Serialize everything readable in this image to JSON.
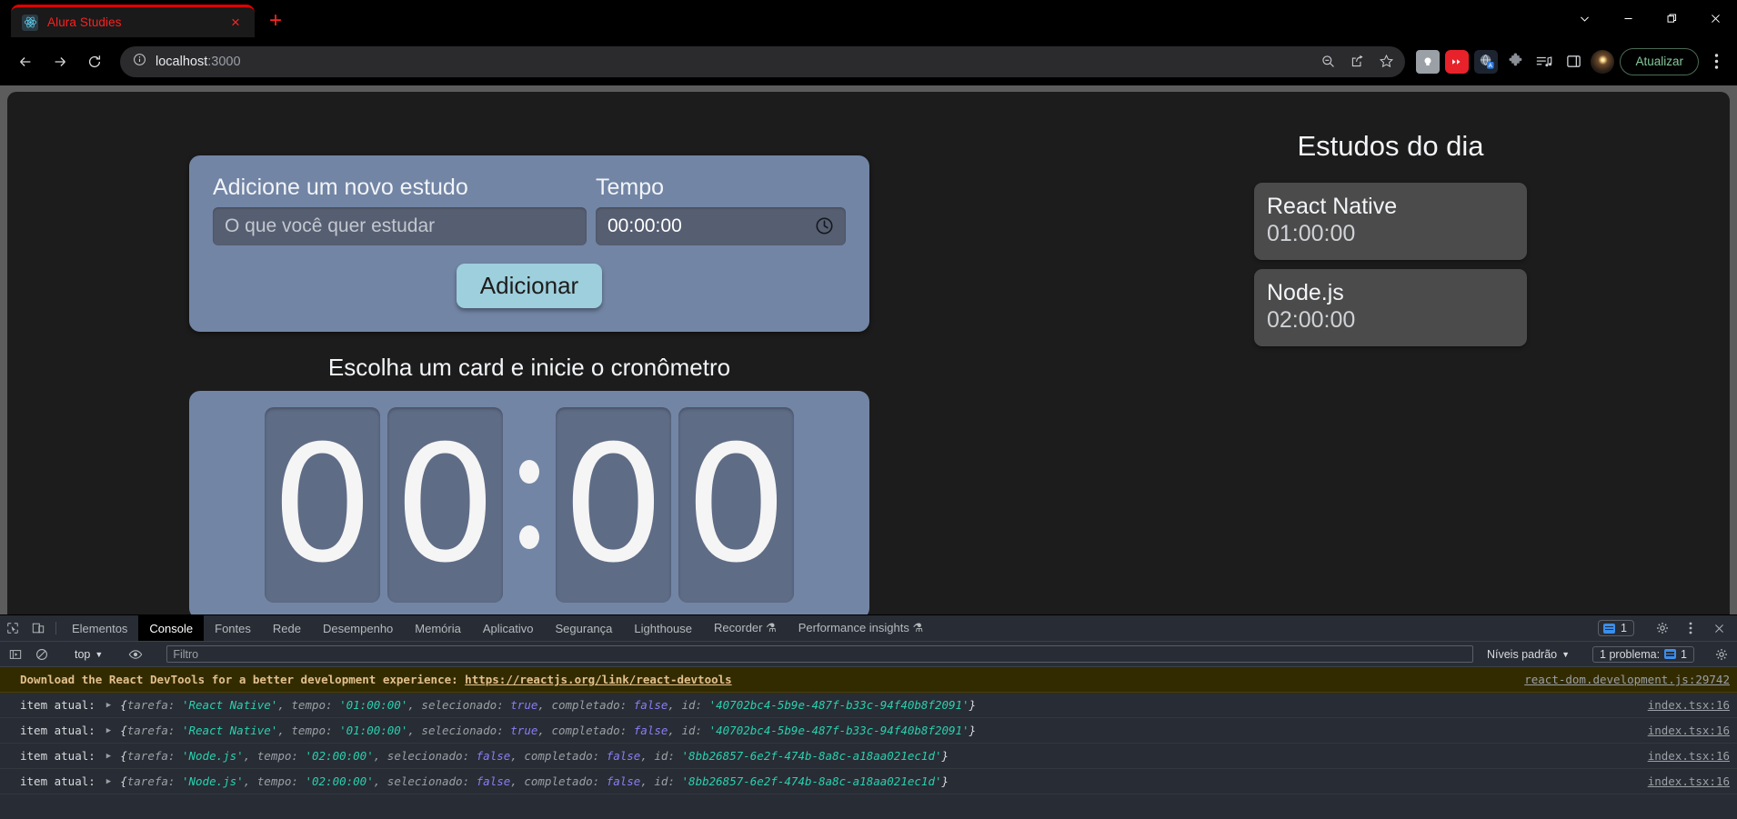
{
  "browser": {
    "tab": {
      "title": "Alura Studies",
      "favicon": "react-icon",
      "close": "×"
    },
    "new_tab_label": "+",
    "window_controls": [
      "tab-search-chevron",
      "minimize",
      "maximize",
      "close"
    ],
    "nav": {
      "back": "←",
      "forward": "→",
      "reload": "⟳"
    },
    "omnibox": {
      "info_icon": "info-circle-icon",
      "url_host": "localhost",
      "url_rest": ":3000",
      "actions": [
        "zoom-out-icon",
        "share-icon",
        "bookmark-star-icon"
      ]
    },
    "extensions": [
      "lightbulb-icon",
      "youtube-icon",
      "translate-icon",
      "puzzle-icon",
      "playlist-icon",
      "sidepanel-icon"
    ],
    "profile": "avatar",
    "update_button": "Atualizar",
    "menu": "kebab-menu"
  },
  "app": {
    "form": {
      "task_label": "Adicione um novo estudo",
      "task_placeholder": "O que você quer estudar",
      "time_label": "Tempo",
      "time_value": "00:00:00",
      "clock_icon": "clock-icon",
      "submit_label": "Adicionar"
    },
    "stopwatch": {
      "title": "Escolha um card e inicie o cronômetro",
      "digits": [
        "0",
        "0",
        "0",
        "0"
      ],
      "separator": ":"
    },
    "list": {
      "title": "Estudos do dia",
      "items": [
        {
          "name": "React Native",
          "time": "01:00:00"
        },
        {
          "name": "Node.js",
          "time": "02:00:00"
        }
      ]
    },
    "colors": {
      "page_bg": "#1c1c1c",
      "panel": "#7285a5",
      "input": "#565e71",
      "accent_button": "#9ecfdc",
      "card": "#4b4b4b",
      "digit": "#5f6c86"
    }
  },
  "devtools": {
    "icons": {
      "inspect": "inspect-element-icon",
      "device": "device-toolbar-icon"
    },
    "tabs": [
      {
        "label": "Elementos",
        "active": false
      },
      {
        "label": "Console",
        "active": true
      },
      {
        "label": "Fontes",
        "active": false
      },
      {
        "label": "Rede",
        "active": false
      },
      {
        "label": "Desempenho",
        "active": false
      },
      {
        "label": "Memória",
        "active": false
      },
      {
        "label": "Aplicativo",
        "active": false
      },
      {
        "label": "Segurança",
        "active": false
      },
      {
        "label": "Lighthouse",
        "active": false
      },
      {
        "label": "Recorder ⚗",
        "active": false
      },
      {
        "label": "Performance insights ⚗",
        "active": false
      }
    ],
    "messages_badge": "1",
    "right_icons": [
      "settings-gear-icon",
      "more-options-icon",
      "close-devtools-icon"
    ],
    "toolbar": {
      "sidebar_toggle": "console-sidebar-icon",
      "clear_console": "clear-console-icon",
      "context": "top",
      "context_caret": "▼",
      "eye": "live-expression-icon",
      "filter_placeholder": "Filtro",
      "levels": "Níveis padrão",
      "levels_caret": "▼",
      "problems": "1 problema:",
      "problems_count": "1",
      "settings": "settings-gear-icon"
    },
    "console_rows": [
      {
        "type": "warning",
        "text": "Download the React DevTools for a better development experience: ",
        "link": "https://reactjs.org/link/react-devtools",
        "source": "react-dom.development.js:29742"
      },
      {
        "type": "log",
        "label": "item atual:",
        "tarefa": "React Native",
        "tempo": "01:00:00",
        "selecionado": "true",
        "completado": "false",
        "id": "40702bc4-5b9e-487f-b33c-94f40b8f2091",
        "source": "index.tsx:16"
      },
      {
        "type": "log",
        "label": "item atual:",
        "tarefa": "React Native",
        "tempo": "01:00:00",
        "selecionado": "true",
        "completado": "false",
        "id": "40702bc4-5b9e-487f-b33c-94f40b8f2091",
        "source": "index.tsx:16"
      },
      {
        "type": "log",
        "label": "item atual:",
        "tarefa": "Node.js",
        "tempo": "02:00:00",
        "selecionado": "false",
        "completado": "false",
        "id": "8bb26857-6e2f-474b-8a8c-a18aa021ec1d",
        "source": "index.tsx:16"
      },
      {
        "type": "log",
        "label": "item atual:",
        "tarefa": "Node.js",
        "tempo": "02:00:00",
        "selecionado": "false",
        "completado": "false",
        "id": "8bb26857-6e2f-474b-8a8c-a18aa021ec1d",
        "source": "index.tsx:16"
      }
    ],
    "token_labels": {
      "open": "{",
      "close": "}",
      "k_tarefa": "tarefa",
      "k_tempo": "tempo",
      "k_selecionado": "selecionado",
      "k_completado": "completado",
      "k_id": "id",
      "colon": ": ",
      "comma": ", ",
      "quote": "'"
    }
  }
}
